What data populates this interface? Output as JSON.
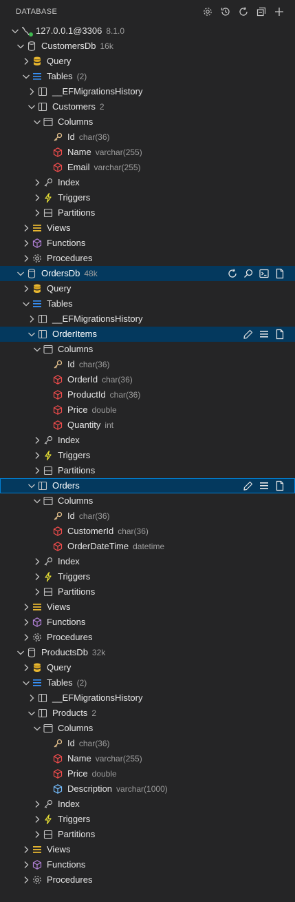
{
  "panel": {
    "title": "DATABASE",
    "actions": [
      "gear-icon",
      "history-icon",
      "refresh-icon",
      "collapse-all-icon",
      "add-icon"
    ]
  },
  "tree": {
    "connection": {
      "label": "127.0.0.1@3306",
      "version": "8.1.0"
    },
    "customers_db": {
      "label": "CustomersDb",
      "size": "16k",
      "query": "Query",
      "tables": {
        "label": "Tables",
        "count": "(2)"
      },
      "ef_history": "__EFMigrationsHistory",
      "customers": {
        "label": "Customers",
        "count": "2",
        "columns_label": "Columns",
        "columns": [
          {
            "name": "Id",
            "type": "char(36)"
          },
          {
            "name": "Name",
            "type": "varchar(255)"
          },
          {
            "name": "Email",
            "type": "varchar(255)"
          }
        ],
        "index": "Index",
        "triggers": "Triggers",
        "partitions": "Partitions"
      },
      "views": "Views",
      "functions": "Functions",
      "procedures": "Procedures"
    },
    "orders_db": {
      "label": "OrdersDb",
      "size": "48k",
      "query": "Query",
      "tables": {
        "label": "Tables"
      },
      "ef_history": "__EFMigrationsHistory",
      "order_items": {
        "label": "OrderItems",
        "columns_label": "Columns",
        "columns": [
          {
            "name": "Id",
            "type": "char(36)"
          },
          {
            "name": "OrderId",
            "type": "char(36)"
          },
          {
            "name": "ProductId",
            "type": "char(36)"
          },
          {
            "name": "Price",
            "type": "double"
          },
          {
            "name": "Quantity",
            "type": "int"
          }
        ],
        "index": "Index",
        "triggers": "Triggers",
        "partitions": "Partitions"
      },
      "orders": {
        "label": "Orders",
        "columns_label": "Columns",
        "columns": [
          {
            "name": "Id",
            "type": "char(36)"
          },
          {
            "name": "CustomerId",
            "type": "char(36)"
          },
          {
            "name": "OrderDateTime",
            "type": "datetime"
          }
        ],
        "index": "Index",
        "triggers": "Triggers",
        "partitions": "Partitions"
      },
      "views": "Views",
      "functions": "Functions",
      "procedures": "Procedures"
    },
    "products_db": {
      "label": "ProductsDb",
      "size": "32k",
      "query": "Query",
      "tables": {
        "label": "Tables",
        "count": "(2)"
      },
      "ef_history": "__EFMigrationsHistory",
      "products": {
        "label": "Products",
        "count": "2",
        "columns_label": "Columns",
        "columns": [
          {
            "name": "Id",
            "type": "char(36)"
          },
          {
            "name": "Name",
            "type": "varchar(255)"
          },
          {
            "name": "Price",
            "type": "double"
          },
          {
            "name": "Description",
            "type": "varchar(1000)"
          }
        ],
        "index": "Index",
        "triggers": "Triggers",
        "partitions": "Partitions"
      },
      "views": "Views",
      "functions": "Functions",
      "procedures": "Procedures"
    }
  },
  "colors": {
    "background": "#252526",
    "selection": "#04395e",
    "focus_border": "#007fd4",
    "key_icon": "#e2c08d",
    "column_icon": "#f14c4c",
    "column_icon_alt": "#75beff",
    "query_icon": "#e8b730",
    "tables_icon": "#3794ff",
    "views_icon": "#e8b730",
    "functions_icon": "#b180d7",
    "triggers_icon": "#e8e035",
    "connected_dot": "#3fb950"
  }
}
